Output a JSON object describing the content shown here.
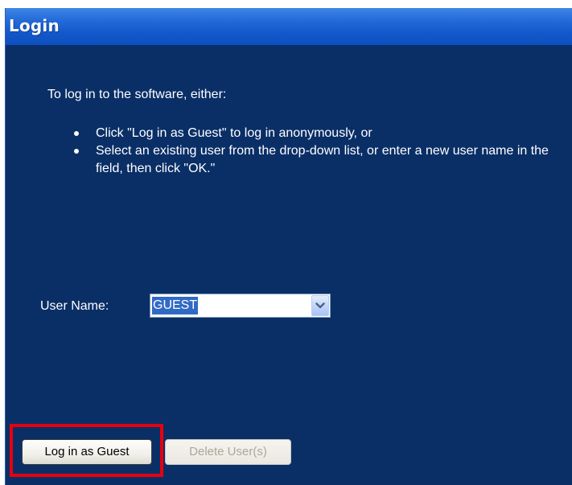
{
  "window": {
    "title": "Login"
  },
  "instructions": {
    "intro": "To log in to the software, either:",
    "bullets": [
      "Click \"Log in as Guest\" to log in anonymously, or",
      "Select an existing user from the drop-down list, or enter a new user name in the field, then click \"OK.\""
    ]
  },
  "user_name": {
    "label": "User Name:",
    "selected_value": "GUEST",
    "icon": "chevron-down-icon"
  },
  "buttons": {
    "guest_label": "Log in as Guest",
    "delete_label": "Delete User(s)",
    "delete_enabled": false
  },
  "colors": {
    "background": "#0a2f67",
    "titlebar": "#2369d9",
    "highlight": "#e8000d",
    "selection": "#316ac5"
  }
}
